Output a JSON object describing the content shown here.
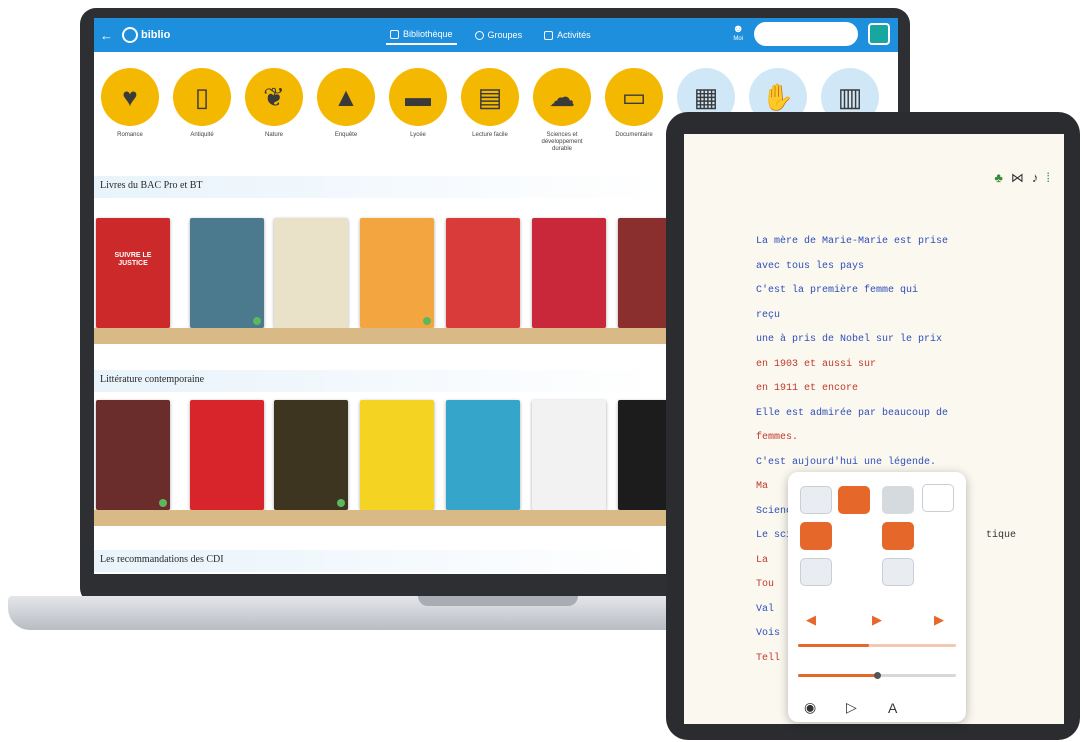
{
  "app": {
    "logo_text": "biblio",
    "nav": [
      {
        "label": "Bibliothèque",
        "active": true
      },
      {
        "label": "Groupes",
        "active": false
      },
      {
        "label": "Activités",
        "active": false
      }
    ],
    "user_label": "Moi",
    "search": {
      "placeholder": "",
      "value": ""
    }
  },
  "categories": [
    {
      "label": "Romance",
      "icon": "balloon-icon",
      "style": "yellow"
    },
    {
      "label": "Antiquité",
      "icon": "column-icon",
      "style": "yellow"
    },
    {
      "label": "Nature",
      "icon": "plant-icon",
      "style": "yellow"
    },
    {
      "label": "Enquête",
      "icon": "detective-hat-icon",
      "style": "yellow"
    },
    {
      "label": "Lycée",
      "icon": "graduation-cap-icon",
      "style": "yellow"
    },
    {
      "label": "Lecture facile",
      "icon": "open-book-icon",
      "style": "yellow"
    },
    {
      "label": "Sciences et développement durable",
      "icon": "tree-cloud-icon",
      "style": "yellow"
    },
    {
      "label": "Documentaire",
      "icon": "tablet-icon",
      "style": "yellow"
    },
    {
      "label": "",
      "icon": "theatre-icon",
      "style": "light"
    },
    {
      "label": "",
      "icon": "hand-icon",
      "style": "light"
    },
    {
      "label": "",
      "icon": "panels-icon",
      "style": "light"
    }
  ],
  "sections": [
    {
      "title": "Livres du BAC Pro et BT"
    },
    {
      "title": "Littérature contemporaine"
    },
    {
      "title": "Les recommandations des CDI"
    }
  ],
  "shelf1": [
    {
      "title": "SUIVRE LE JUSTICE",
      "bg": "#cc2a2a",
      "check": false
    },
    {
      "title": "",
      "bg": "#4b7a8e",
      "check": true
    },
    {
      "title": "",
      "bg": "#e9e2c8",
      "check": false
    },
    {
      "title": "",
      "bg": "#f3a640",
      "check": true
    },
    {
      "title": "",
      "bg": "#d93a3a",
      "check": false
    },
    {
      "title": "",
      "bg": "#c8283a",
      "check": false
    },
    {
      "title": "",
      "bg": "#8a2e2e",
      "check": false
    }
  ],
  "shelf2": [
    {
      "title": "",
      "bg": "#6b2c2c",
      "check": true
    },
    {
      "title": "",
      "bg": "#d8252c",
      "check": false
    },
    {
      "title": "",
      "bg": "#3d3520",
      "check": true
    },
    {
      "title": "",
      "bg": "#f4d323",
      "check": false
    },
    {
      "title": "",
      "bg": "#35a6c9",
      "check": false
    },
    {
      "title": "",
      "bg": "#f2f2f2",
      "check": false
    },
    {
      "title": "",
      "bg": "#1c1c1c",
      "check": false
    }
  ],
  "reader": {
    "lines": [
      {
        "text": "La mère de Marie-Marie est prise",
        "color": "blue"
      },
      {
        "text": "avec tous les pays",
        "color": "blue"
      },
      {
        "text": "C'est la première femme qui",
        "color": "blue"
      },
      {
        "text": "reçu",
        "color": "blue"
      },
      {
        "text": "une à pris de Nobel sur le prix",
        "color": "blue"
      },
      {
        "text": "en 1903 et aussi sur",
        "color": "red"
      },
      {
        "text": "en 1911 et encore",
        "color": "red"
      },
      {
        "text": "Elle est admirée par beaucoup de",
        "color": "blue"
      },
      {
        "text": "femmes.",
        "color": "red"
      },
      {
        "text": "C'est aujourd'hui une légende.",
        "color": "blue"
      },
      {
        "text": "Ma",
        "color": "red"
      },
      {
        "text": "Sciences",
        "color": "blue"
      },
      {
        "text": "Le scientifique",
        "color": "blue"
      },
      {
        "text": "La",
        "color": "red"
      },
      {
        "text": "Tou",
        "color": "red"
      },
      {
        "text": "Val",
        "color": "blue"
      },
      {
        "text": "Vois",
        "color": "blue"
      },
      {
        "text": "Tell",
        "color": "red"
      }
    ],
    "line_extra": "tique",
    "tools": [
      "accessibility-icon",
      "bookmark-icon",
      "audio-icon",
      "settings-icon"
    ]
  },
  "player": {
    "progress_fraction": 0.45,
    "volume_fraction": 0.5
  },
  "colors": {
    "topbar": "#1e8fdc",
    "accent_yellow": "#f5b800",
    "accent_orange": "#e6672a"
  }
}
